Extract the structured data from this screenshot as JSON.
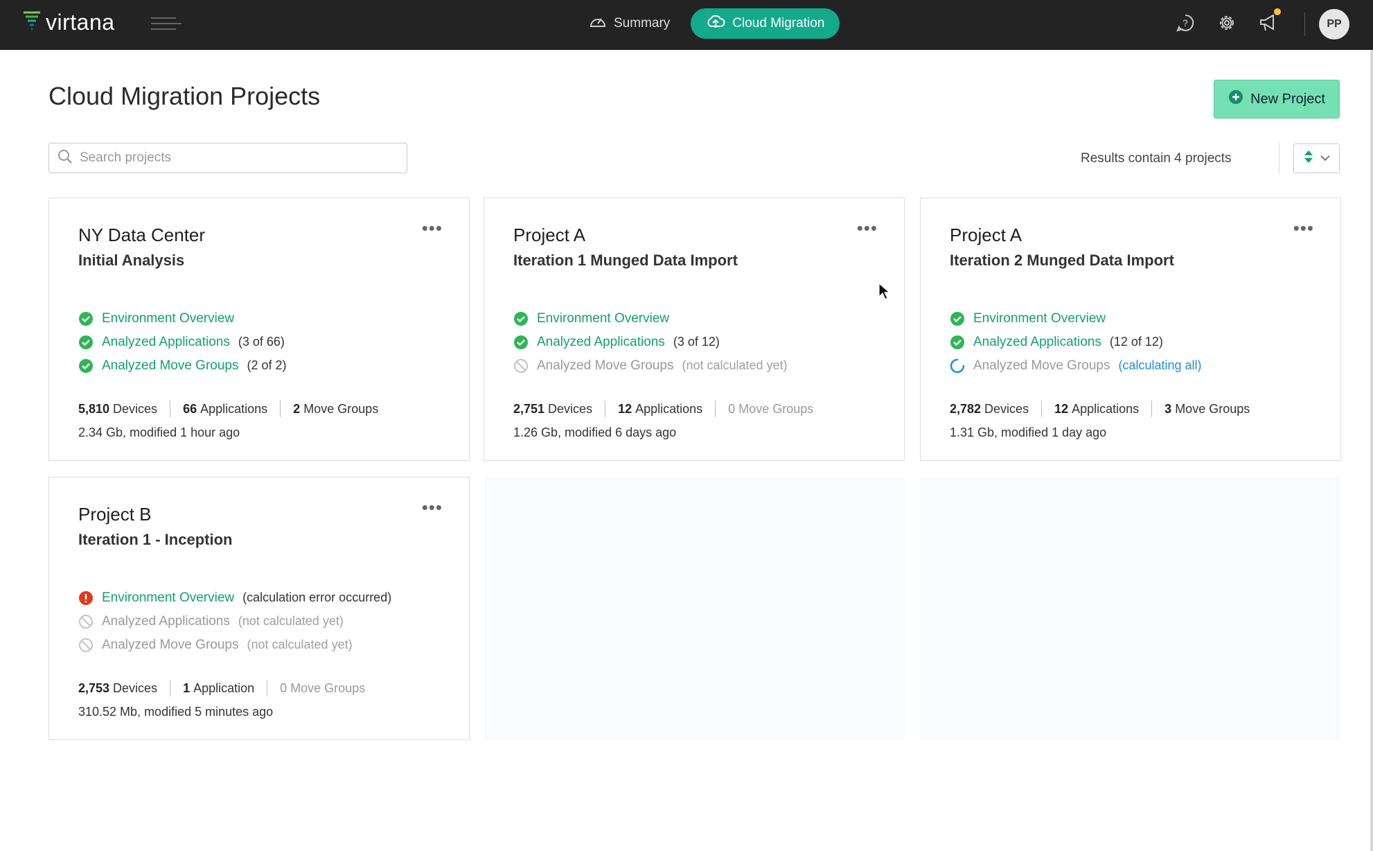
{
  "app": {
    "brand": "virtana"
  },
  "nav": {
    "summary_label": "Summary",
    "cloud_label": "Cloud Migration"
  },
  "user": {
    "initials": "PP"
  },
  "page": {
    "title": "Cloud Migration Projects",
    "new_project_label": "New Project",
    "search_placeholder": "Search projects",
    "results_text": "Results contain 4 projects"
  },
  "projects": [
    {
      "title": "NY Data Center",
      "subtitle": "Initial Analysis",
      "statuses": [
        {
          "label": "Environment Overview",
          "state": "done",
          "detail": ""
        },
        {
          "label": "Analyzed Applications",
          "state": "done",
          "detail": "(3 of 66)"
        },
        {
          "label": "Analyzed Move Groups",
          "state": "done",
          "detail": "(2 of 2)"
        }
      ],
      "devices": "5,810",
      "devices_label": "Devices",
      "apps": "66",
      "apps_label": "Applications",
      "groups": "2",
      "groups_label": "Move Groups",
      "meta": "2.34 Gb, modified 1 hour ago"
    },
    {
      "title": "Project A",
      "subtitle": "Iteration 1 Munged Data Import",
      "statuses": [
        {
          "label": "Environment Overview",
          "state": "done",
          "detail": ""
        },
        {
          "label": "Analyzed Applications",
          "state": "done",
          "detail": "(3 of 12)"
        },
        {
          "label": "Analyzed Move Groups",
          "state": "none",
          "detail": "(not calculated yet)"
        }
      ],
      "devices": "2,751",
      "devices_label": "Devices",
      "apps": "12",
      "apps_label": "Applications",
      "groups": "0 Move Groups",
      "meta": "1.26 Gb, modified 6 days ago"
    },
    {
      "title": "Project A",
      "subtitle": "Iteration 2 Munged Data Import",
      "statuses": [
        {
          "label": "Environment Overview",
          "state": "done",
          "detail": ""
        },
        {
          "label": "Analyzed Applications",
          "state": "done",
          "detail": "(12 of 12)"
        },
        {
          "label": "Analyzed Move Groups",
          "state": "calculating",
          "detail": "(calculating all)"
        }
      ],
      "devices": "2,782",
      "devices_label": "Devices",
      "apps": "12",
      "apps_label": "Applications",
      "groups": "3",
      "groups_label": "Move Groups",
      "meta": "1.31 Gb, modified 1 day ago"
    },
    {
      "title": "Project B",
      "subtitle": "Iteration 1 - Inception",
      "statuses": [
        {
          "label": "Environment Overview",
          "state": "error",
          "detail": "(calculation error occurred)"
        },
        {
          "label": "Analyzed Applications",
          "state": "none",
          "detail": "(not calculated yet)"
        },
        {
          "label": "Analyzed Move Groups",
          "state": "none",
          "detail": "(not calculated yet)"
        }
      ],
      "devices": "2,753",
      "devices_label": "Devices",
      "apps": "1",
      "apps_label": "Application",
      "groups": "0 Move Groups",
      "meta": "310.52 Mb, modified 5 minutes ago"
    }
  ],
  "colors": {
    "accent": "#13a98a",
    "success": "#2db556",
    "error": "#e03a1e",
    "progress": "#1e8fe1",
    "topbar": "#232323"
  },
  "icons": [
    "virtana-logo-icon",
    "hamburger-icon",
    "speedometer-icon",
    "cloud-icon",
    "help-icon",
    "gear-icon",
    "megaphone-icon",
    "search-icon",
    "plus-circle-icon",
    "sort-icon",
    "chevron-down-icon",
    "check-circle-icon",
    "ban-icon",
    "spinner-icon",
    "error-icon",
    "more-icon"
  ]
}
